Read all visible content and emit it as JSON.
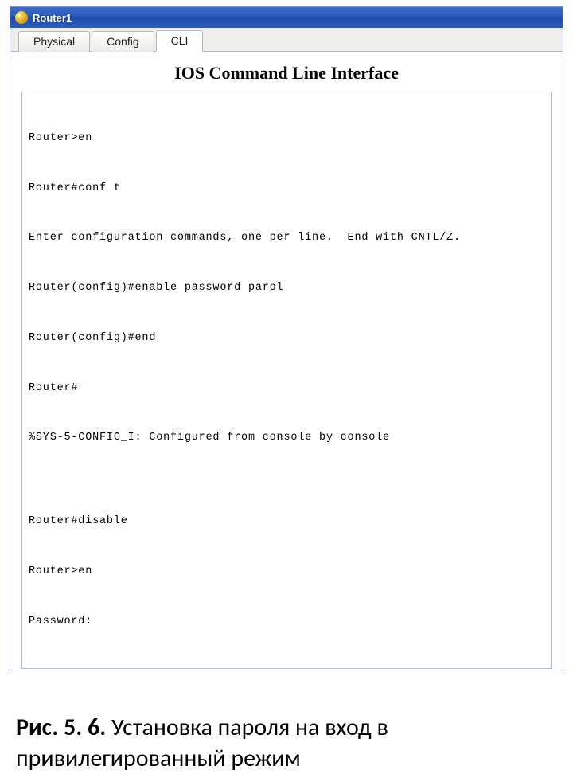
{
  "window": {
    "title": "Router1"
  },
  "tabs": [
    {
      "label": "Physical",
      "active": false
    },
    {
      "label": "Config",
      "active": false
    },
    {
      "label": "CLI",
      "active": true
    }
  ],
  "cli_heading": "IOS Command Line Interface",
  "terminal_lines": [
    "Router>en",
    "Router#conf t",
    "Enter configuration commands, one per line.  End with CNTL/Z.",
    "Router(config)#enable password parol",
    "Router(config)#end",
    "Router#",
    "%SYS-5-CONFIG_I: Configured from console by console",
    "",
    "Router#disable",
    "Router>en",
    "Password:"
  ],
  "caption": {
    "label": "Рис. 5. 6.",
    "text": " Установка пароля на вход в привилегированный режим"
  }
}
